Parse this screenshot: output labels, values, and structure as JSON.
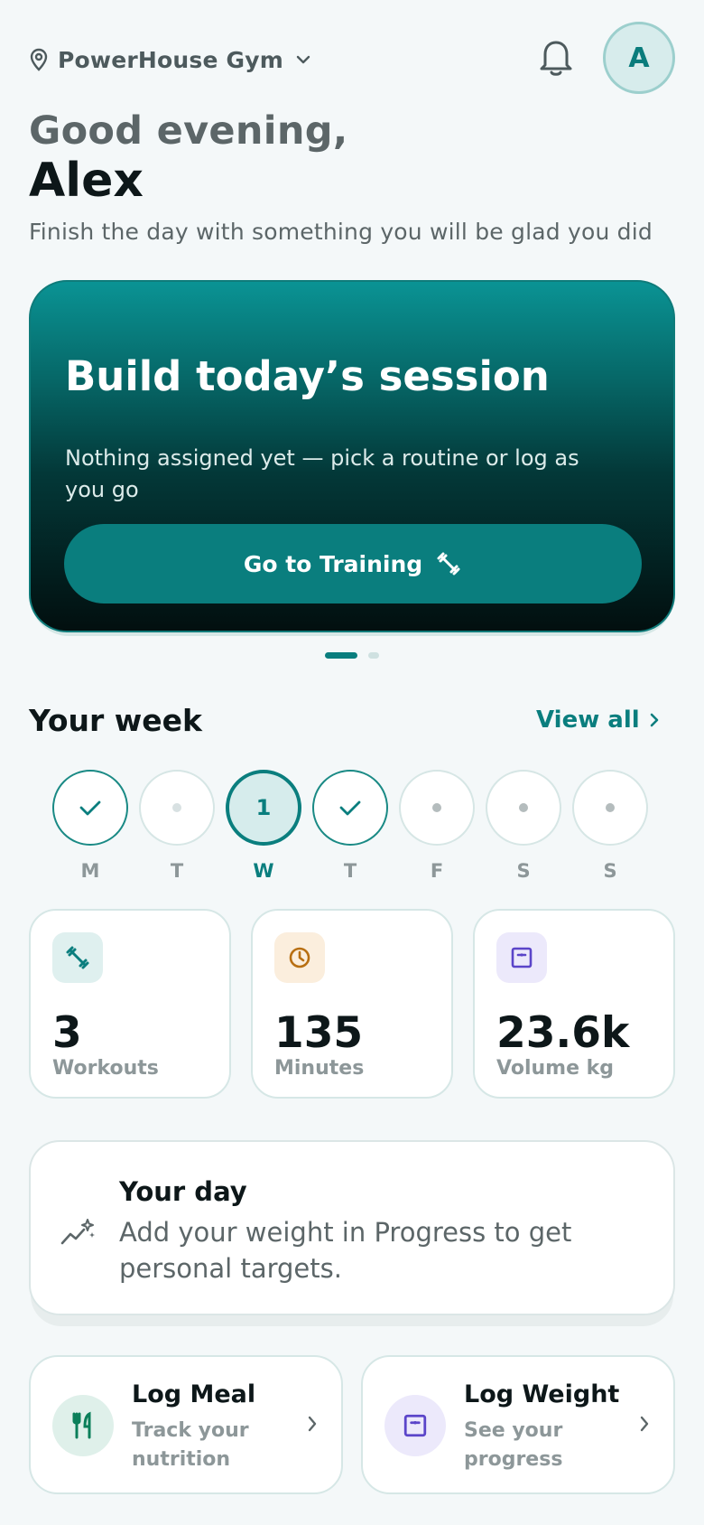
{
  "header": {
    "gym_name": "PowerHouse Gym",
    "avatar_initial": "A"
  },
  "greeting": {
    "salutation": "Good evening,",
    "name": "Alex",
    "subtitle": "Finish the day with something you will be glad you did"
  },
  "hero": {
    "title": "Build today’s session",
    "description": "Nothing assigned yet — pick a routine or log as you go",
    "button_label": "Go to Training",
    "pages": 2,
    "active_page": 1
  },
  "week": {
    "title": "Your week",
    "view_all_label": "View all",
    "days": [
      {
        "label": "M",
        "state": "done",
        "value": ""
      },
      {
        "label": "T",
        "state": "empty",
        "value": ""
      },
      {
        "label": "W",
        "state": "today",
        "value": "1"
      },
      {
        "label": "T",
        "state": "done",
        "value": ""
      },
      {
        "label": "F",
        "state": "upcoming",
        "value": ""
      },
      {
        "label": "S",
        "state": "upcoming",
        "value": ""
      },
      {
        "label": "S",
        "state": "upcoming",
        "value": ""
      }
    ]
  },
  "stats": [
    {
      "value": "3",
      "label": "Workouts",
      "icon": "dumbbell-icon"
    },
    {
      "value": "135",
      "label": "Minutes",
      "icon": "clock-icon"
    },
    {
      "value": "23.6k",
      "label": "Volume kg",
      "icon": "scale-icon"
    }
  ],
  "your_day": {
    "title": "Your day",
    "text": "Add your weight in Progress to get personal targets."
  },
  "actions": [
    {
      "title": "Log Meal",
      "subtitle": "Track your nutrition",
      "icon": "fork-knife-icon"
    },
    {
      "title": "Log Weight",
      "subtitle": "See your progress",
      "icon": "scale-icon"
    }
  ],
  "colors": {
    "accent": "#0a7e7e",
    "background": "#f4f8f9",
    "stat_green_bg": "#dff0ef",
    "stat_amber_bg": "#fbeedd",
    "stat_purple_bg": "#ece9fb"
  }
}
